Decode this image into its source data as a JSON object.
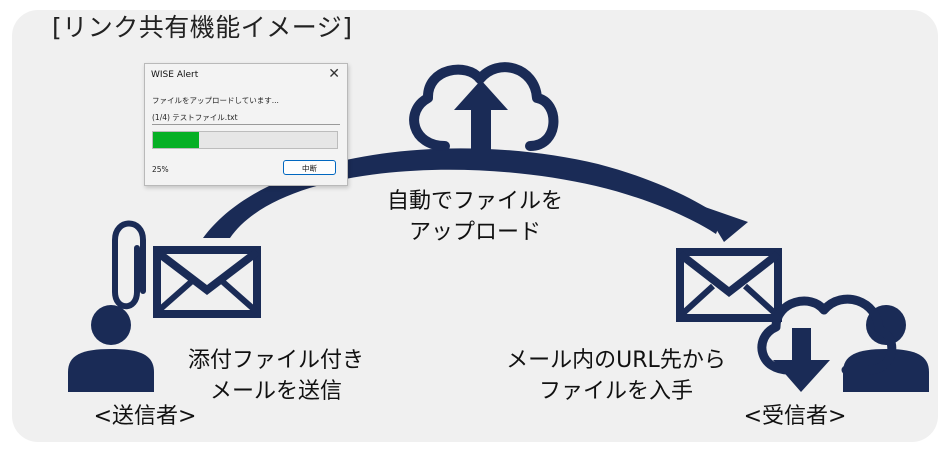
{
  "title": "[リンク共有機能イメージ]",
  "dialog": {
    "title": "WISE Alert",
    "close_glyph": "✕",
    "message": "ファイルをアップロードしています...",
    "file": "(1/4) テストファイル.txt",
    "progress": 0.25,
    "percent_label": "25%",
    "cancel_label": "中断"
  },
  "labels": {
    "auto_upload": [
      "自動でファイルを",
      "アップロード"
    ],
    "send_mail": [
      "添付ファイル付き",
      "メールを送信"
    ],
    "get_file": [
      "メール内のURL先から",
      "ファイルを入手"
    ]
  },
  "roles": {
    "sender": "<送信者>",
    "receiver": "<受信者>"
  },
  "colors": {
    "icon": "#1a2b56",
    "panel": "#f0f0f0",
    "progress": "#06b025"
  },
  "icons": [
    "user-icon",
    "paperclip-icon",
    "envelope-icon",
    "cloud-upload-icon",
    "cloud-download-icon",
    "arc-arrow"
  ]
}
